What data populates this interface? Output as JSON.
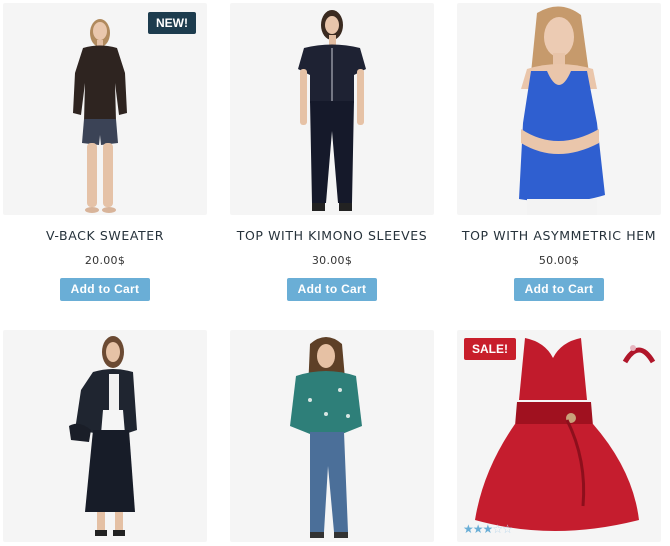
{
  "colors": {
    "accent": "#6aaed6",
    "new_badge": "#1d3c4e",
    "sale_badge": "#c81e2b"
  },
  "products": [
    {
      "name": "V-BACK SWEATER",
      "price": "20.00$",
      "button": "Add to Cart",
      "badge": "NEW!"
    },
    {
      "name": "TOP WITH KIMONO SLEEVES",
      "price": "30.00$",
      "button": "Add to Cart"
    },
    {
      "name": "TOP WITH ASYMMETRIC HEM",
      "price": "50.00$",
      "button": "Add to Cart"
    },
    {
      "name": "",
      "price": "",
      "button": ""
    },
    {
      "name": "",
      "price": "",
      "button": ""
    },
    {
      "name": "",
      "price": "",
      "button": "",
      "badge": "SALE!",
      "rating": 3,
      "rating_max": 5
    }
  ]
}
